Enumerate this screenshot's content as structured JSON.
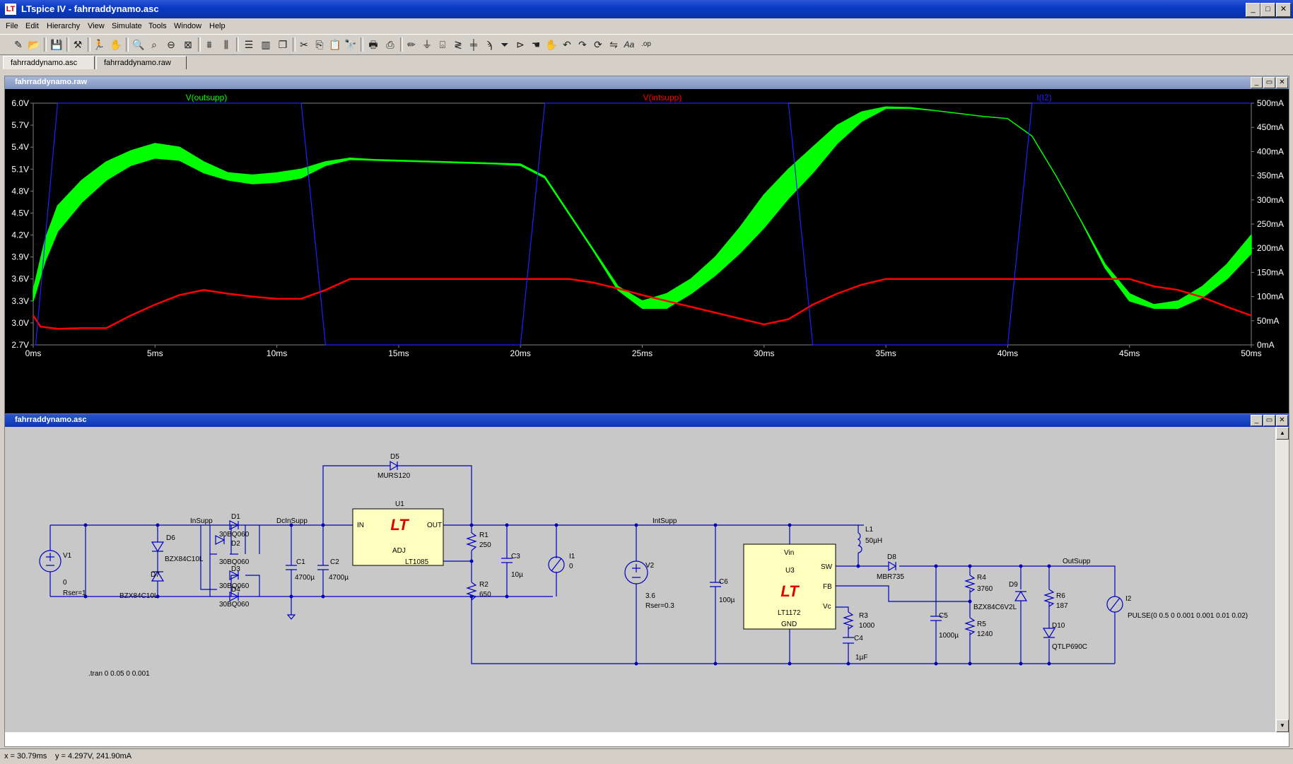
{
  "app": {
    "title": "LTspice IV - fahrraddynamo.asc"
  },
  "window_controls": {
    "min": "_",
    "max": "□",
    "close": "✕"
  },
  "menu": [
    "File",
    "Edit",
    "Hierarchy",
    "View",
    "Simulate",
    "Tools",
    "Window",
    "Help"
  ],
  "toolbar_icons": [
    "new-schematic",
    "open",
    "save",
    "control-panel",
    "run",
    "halt",
    "zoom-in",
    "zoom-pan",
    "zoom-out",
    "zoom-fit",
    "autorange",
    "fit-x",
    "tile-horizontal",
    "tile-vertical",
    "cascade",
    "cut",
    "copy",
    "paste",
    "find",
    "print-preview",
    "print",
    "draw-wire",
    "ground",
    "label-net",
    "resistor",
    "capacitor",
    "inductor",
    "diode",
    "component",
    "move",
    "drag",
    "undo",
    "redo",
    "rotate",
    "mirror",
    "text",
    "spice-directive"
  ],
  "tabs": [
    "fahrraddynamo.asc",
    "fahrraddynamo.raw"
  ],
  "waveform": {
    "title": "fahrraddynamo.raw",
    "traces": [
      {
        "name": "V(outsupp)",
        "color": "#00ff00"
      },
      {
        "name": "V(intsupp)",
        "color": "#ff0000"
      },
      {
        "name": "I(I2)",
        "color": "#2020ff"
      }
    ]
  },
  "chart_data": {
    "type": "line",
    "title": "",
    "xlabel": "",
    "ylabel_left": "",
    "ylabel_right": "",
    "x_ticks": [
      "0ms",
      "5ms",
      "10ms",
      "15ms",
      "20ms",
      "25ms",
      "30ms",
      "35ms",
      "40ms",
      "45ms",
      "50ms"
    ],
    "y_left_ticks": [
      "6.0V",
      "5.7V",
      "5.4V",
      "5.1V",
      "4.8V",
      "4.5V",
      "4.2V",
      "3.9V",
      "3.6V",
      "3.3V",
      "3.0V",
      "2.7V"
    ],
    "y_right_ticks": [
      "500mA",
      "450mA",
      "400mA",
      "350mA",
      "300mA",
      "250mA",
      "200mA",
      "150mA",
      "100mA",
      "50mA",
      "0mA"
    ],
    "xlim_ms": [
      0,
      50
    ],
    "ylim_left_V": [
      2.7,
      6.0
    ],
    "ylim_right_mA": [
      0,
      500
    ],
    "grid": false,
    "series": [
      {
        "name": "V(outsupp)",
        "color": "#00ff00",
        "axis": "left",
        "x_ms": [
          0,
          0.5,
          1,
          2,
          3,
          4,
          5,
          6,
          7,
          8,
          9,
          10,
          11,
          12,
          13,
          14,
          15,
          16,
          17,
          18,
          19,
          20,
          21,
          22,
          23,
          24,
          25,
          26,
          27,
          28,
          29,
          30,
          31,
          32,
          33,
          34,
          35,
          36,
          37,
          38,
          39,
          40,
          41,
          42,
          43,
          44,
          45,
          46,
          47,
          48,
          49,
          50
        ],
        "upper": [
          3.45,
          4.15,
          4.6,
          4.95,
          5.2,
          5.35,
          5.45,
          5.4,
          5.2,
          5.05,
          5.02,
          5.05,
          5.1,
          5.2,
          5.25,
          5.23,
          5.22,
          5.21,
          5.2,
          5.19,
          5.18,
          5.17,
          5.0,
          4.5,
          4.0,
          3.5,
          3.3,
          3.4,
          3.6,
          3.9,
          4.3,
          4.75,
          5.1,
          5.4,
          5.7,
          5.88,
          5.95,
          5.94,
          5.9,
          5.86,
          5.82,
          5.79,
          5.55,
          5.0,
          4.4,
          3.8,
          3.4,
          3.25,
          3.3,
          3.5,
          3.8,
          4.2
        ],
        "lower": [
          3.3,
          3.85,
          4.25,
          4.65,
          4.95,
          5.15,
          5.25,
          5.22,
          5.05,
          4.95,
          4.9,
          4.92,
          4.98,
          5.15,
          5.23,
          5.22,
          5.21,
          5.2,
          5.19,
          5.18,
          5.17,
          5.15,
          4.98,
          4.48,
          3.98,
          3.45,
          3.2,
          3.2,
          3.4,
          3.65,
          3.95,
          4.3,
          4.7,
          5.05,
          5.45,
          5.75,
          5.93,
          5.93,
          5.9,
          5.86,
          5.82,
          5.79,
          5.55,
          5.0,
          4.4,
          3.75,
          3.3,
          3.2,
          3.2,
          3.35,
          3.6,
          3.95
        ]
      },
      {
        "name": "V(intsupp)",
        "color": "#ff0000",
        "axis": "left",
        "x_ms": [
          0,
          0.3,
          1,
          2,
          3,
          4,
          5,
          6,
          7,
          8,
          9,
          10,
          11,
          12,
          13,
          14,
          15,
          16,
          17,
          18,
          19,
          20,
          21,
          22,
          23,
          24,
          25,
          26,
          27,
          28,
          29,
          30,
          31,
          32,
          33,
          34,
          35,
          36,
          37,
          38,
          39,
          40,
          41,
          42,
          43,
          44,
          45,
          46,
          47,
          48,
          49,
          50
        ],
        "values": [
          3.1,
          2.95,
          2.92,
          2.93,
          2.93,
          3.1,
          3.25,
          3.38,
          3.45,
          3.4,
          3.36,
          3.33,
          3.33,
          3.45,
          3.6,
          3.6,
          3.6,
          3.6,
          3.6,
          3.6,
          3.6,
          3.6,
          3.6,
          3.6,
          3.55,
          3.47,
          3.38,
          3.3,
          3.22,
          3.14,
          3.06,
          2.98,
          3.05,
          3.25,
          3.4,
          3.52,
          3.6,
          3.6,
          3.6,
          3.6,
          3.6,
          3.6,
          3.6,
          3.6,
          3.6,
          3.6,
          3.6,
          3.5,
          3.45,
          3.35,
          3.22,
          3.1
        ]
      },
      {
        "name": "I(I2)",
        "color": "#2020ff",
        "axis": "right",
        "x_ms": [
          0,
          0.1,
          1.0,
          11.0,
          12.0,
          20.0,
          21.0,
          31.0,
          32.0,
          40.0,
          41.0,
          50.0
        ],
        "values": [
          0,
          0,
          500,
          500,
          0,
          0,
          500,
          500,
          0,
          0,
          500,
          500
        ]
      }
    ]
  },
  "schematic": {
    "title": "fahrraddynamo.asc",
    "net_labels": {
      "insupp": "InSupp",
      "dcinsupp": "DcInSupp",
      "intsupp": "IntSupp",
      "outsupp": "OutSupp"
    },
    "components": {
      "v1": {
        "ref": "V1",
        "value": "0",
        "extra": "Rser=1"
      },
      "d6": {
        "ref": "D6",
        "value": "BZX84C10L"
      },
      "d7": {
        "ref": "D7",
        "value": "BZX84C10L"
      },
      "d1": {
        "ref": "D1",
        "value": "30BQ060"
      },
      "d2": {
        "ref": "D2",
        "value": "30BQ060"
      },
      "d3": {
        "ref": "D3",
        "value": "30BQ060"
      },
      "d4": {
        "ref": "D4",
        "value": "30BQ060"
      },
      "c1": {
        "ref": "C1",
        "value": "4700µ"
      },
      "c2": {
        "ref": "C2",
        "value": "4700µ"
      },
      "d5": {
        "ref": "D5",
        "value": "MURS120"
      },
      "u1": {
        "ref": "U1",
        "value": "LT1085",
        "pin_in": "IN",
        "pin_out": "OUT",
        "pin_adj": "ADJ"
      },
      "r1": {
        "ref": "R1",
        "value": "250"
      },
      "r2": {
        "ref": "R2",
        "value": "650"
      },
      "c3": {
        "ref": "C3",
        "value": "10µ"
      },
      "i1": {
        "ref": "I1",
        "value": "0"
      },
      "v2": {
        "ref": "V2",
        "value": "3.6",
        "extra": "Rser=0.3"
      },
      "c6": {
        "ref": "C6",
        "value": "100µ"
      },
      "u3": {
        "ref": "U3",
        "value": "LT1172",
        "pin_vin": "Vin",
        "pin_sw": "SW",
        "pin_fb": "FB",
        "pin_vc": "Vc",
        "pin_gnd": "GND"
      },
      "l1": {
        "ref": "L1",
        "value": "50µH"
      },
      "d8": {
        "ref": "D8",
        "value": "MBR735"
      },
      "r3": {
        "ref": "R3",
        "value": "1000"
      },
      "c4": {
        "ref": "C4",
        "value": "1µF"
      },
      "c5": {
        "ref": "C5",
        "value": "1000µ"
      },
      "r4": {
        "ref": "R4",
        "value": "3760"
      },
      "r5": {
        "ref": "R5",
        "value": "1240"
      },
      "d9": {
        "ref": "D9",
        "value": "BZX84C6V2L"
      },
      "r6": {
        "ref": "R6",
        "value": "187"
      },
      "d10": {
        "ref": "D10",
        "value": "QTLP690C"
      },
      "i2": {
        "ref": "I2",
        "value": "PULSE(0 0.5 0 0.001 0.001 0.01 0.02)"
      }
    },
    "directive": ".tran 0 0.05 0 0.001",
    "wire_color": "#0000c0",
    "lt_logo_color": "#e00000"
  },
  "status": {
    "x": "x = 30.79ms",
    "y": "y = 4.297V, 241.90mA"
  }
}
